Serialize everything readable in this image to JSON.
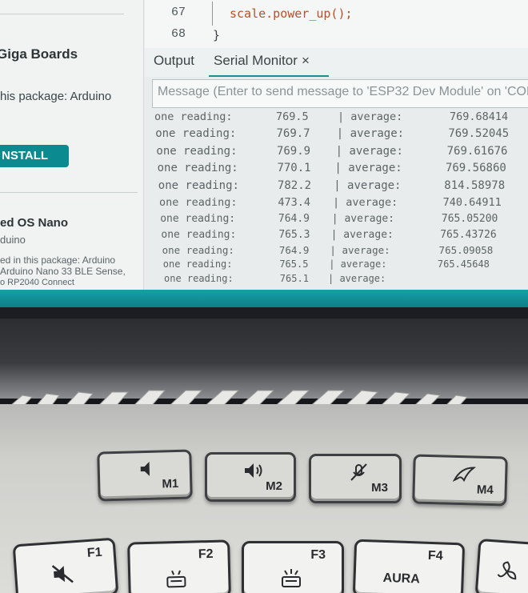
{
  "boards_manager": {
    "top_title": "Giga Boards",
    "top_package": "his package: Arduino",
    "install_label": "NSTALL",
    "second_title": "ed OS Nano",
    "second_author": "duino",
    "second_desc_1": "ed in this package: Arduino",
    "second_desc_2": "Arduino Nano 33 BLE Sense,",
    "second_desc_3": "o RP2040 Connect"
  },
  "editor": {
    "lines": [
      {
        "number": "67",
        "code": "scale.power_up();"
      },
      {
        "number": "68",
        "code": "}"
      }
    ]
  },
  "panel_tabs": {
    "output": "Output",
    "serial_monitor": "Serial Monitor",
    "close_glyph": "×"
  },
  "serial_monitor": {
    "placeholder": "Message (Enter to send message to 'ESP32 Dev Module' on 'COM",
    "rows": [
      {
        "label": "one reading:",
        "reading": "769.5",
        "avg_label": "| average:",
        "average": "769.68414"
      },
      {
        "label": "one reading:",
        "reading": "769.7",
        "avg_label": "| average:",
        "average": "769.52045"
      },
      {
        "label": "one reading:",
        "reading": "769.9",
        "avg_label": "| average:",
        "average": "769.61676"
      },
      {
        "label": "one reading:",
        "reading": "770.1",
        "avg_label": "| average:",
        "average": "769.56860"
      },
      {
        "label": "one reading:",
        "reading": "782.2",
        "avg_label": "| average:",
        "average": "814.58978"
      },
      {
        "label": "one reading:",
        "reading": "473.4",
        "avg_label": "| average:",
        "average": "740.64911"
      },
      {
        "label": "one reading:",
        "reading": "764.9",
        "avg_label": "| average:",
        "average": "765.05200"
      },
      {
        "label": "one reading:",
        "reading": "765.3",
        "avg_label": "| average:",
        "average": "765.43726"
      },
      {
        "label": "one reading:",
        "reading": "764.9",
        "avg_label": "| average:",
        "average": "765.09058"
      },
      {
        "label": "one reading:",
        "reading": "765.5",
        "avg_label": "| average:",
        "average": "765.45648"
      },
      {
        "label": "one reading:",
        "reading": "765.1",
        "avg_label": "| average:",
        "average": ""
      }
    ]
  },
  "keyboard": {
    "macro_keys": [
      {
        "label": "M1",
        "icon": "volume-down-icon"
      },
      {
        "label": "M2",
        "icon": "volume-up-icon"
      },
      {
        "label": "M3",
        "icon": "mic-mute-icon"
      },
      {
        "label": "M4",
        "icon": "rog-logo-icon"
      }
    ],
    "function_keys": [
      {
        "label": "F1",
        "icon": "mute-icon",
        "word": ""
      },
      {
        "label": "F2",
        "icon": "backlight-down-icon",
        "word": ""
      },
      {
        "label": "F3",
        "icon": "backlight-up-icon",
        "word": ""
      },
      {
        "label": "F4",
        "icon": "",
        "word": "AURA"
      }
    ]
  }
}
